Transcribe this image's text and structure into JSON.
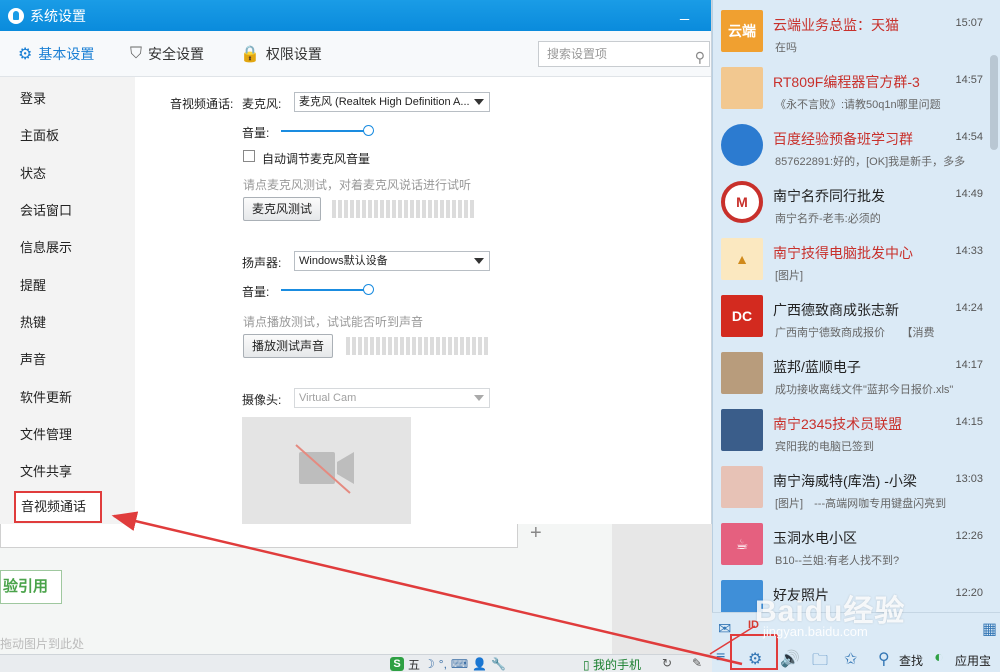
{
  "window": {
    "title": "系统设置"
  },
  "tabs": [
    {
      "label": "基本设置",
      "icon": "gear-icon"
    },
    {
      "label": "安全设置",
      "icon": "shield-icon"
    },
    {
      "label": "权限设置",
      "icon": "lock-icon"
    }
  ],
  "search": {
    "placeholder": "搜索设置项"
  },
  "sidebar": {
    "items": [
      "登录",
      "主面板",
      "状态",
      "会话窗口",
      "信息展示",
      "提醒",
      "热键",
      "声音",
      "软件更新",
      "文件管理",
      "文件共享",
      "音视频通话"
    ],
    "active": "音视频通话"
  },
  "av": {
    "section_label": "音视频通话:",
    "mic_label": "麦克风:",
    "mic_value": "麦克风 (Realtek High Definition A...",
    "volume_label": "音量:",
    "auto_adjust_label": "自动调节麦克风音量",
    "auto_adjust_checked": false,
    "mic_hint": "请点麦克风测试，对着麦克风说话进行试听",
    "mic_test_button": "麦克风测试",
    "speaker_label": "扬声器:",
    "speaker_value": "Windows默认设备",
    "speaker_volume_label": "音量:",
    "speaker_hint": "请点播放测试，试试能否听到声音",
    "speaker_test_button": "播放测试声音",
    "camera_label": "摄像头:",
    "camera_value": "Virtual Cam",
    "mic_volume": 1.0,
    "speaker_volume": 1.0
  },
  "background": {
    "quote_button": "验引用",
    "drag_hint": "拖动图片到此处",
    "plus": "+"
  },
  "taskbar": {
    "ime_label": "五",
    "phone_label": "我的手机"
  },
  "chats": [
    {
      "name": "云端业务总监：天猫",
      "time": "15:07",
      "preview": "在吗",
      "red": true,
      "avatar": "orange-box-avatar",
      "avatar_text": "云端"
    },
    {
      "name": "RT809F编程器官方群-3",
      "time": "14:57",
      "preview": "《永不言败》:请教50q1n哪里问题",
      "red": true,
      "avatar": "handshake-avatar",
      "avatar_text": ""
    },
    {
      "name": "百度经验预备班学习群",
      "time": "14:54",
      "preview": "857622891:好的，[OK]我是新手，多多",
      "red": true,
      "avatar": "paw-logo-avatar",
      "avatar_text": ""
    },
    {
      "name": "南宁名乔同行批发",
      "time": "14:49",
      "preview": "南宁名乔-老韦:必须的",
      "red": false,
      "avatar": "m-logo-avatar",
      "avatar_text": "M"
    },
    {
      "name": "南宁技得电脑批发中心",
      "time": "14:33",
      "preview": "[图片]",
      "red": true,
      "avatar": "tech-logo-avatar",
      "avatar_text": "▲"
    },
    {
      "name": "广西德致商成张志新",
      "time": "14:24",
      "preview": "广西南宁德致商成报价　　【消费",
      "red": false,
      "avatar": "dc-logo-avatar",
      "avatar_text": "DC"
    },
    {
      "name": "蓝邦/蓝顺电子",
      "time": "14:17",
      "preview": "成功接收离线文件\"蓝邦今日报价.xls\"",
      "red": false,
      "avatar": "photo-avatar",
      "avatar_text": ""
    },
    {
      "name": "南宁2345技术员联盟",
      "time": "14:15",
      "preview": "宾阳我的电脑已签到",
      "red": true,
      "avatar": "octopus-avatar",
      "avatar_text": ""
    },
    {
      "name": "南宁海威特(库浩) -小梁",
      "time": "13:03",
      "preview": "[图片]　---高端网咖专用键盘闪亮到",
      "red": false,
      "avatar": "girl-photo-avatar",
      "avatar_text": ""
    },
    {
      "name": "玉洞水电小区",
      "time": "12:26",
      "preview": "B10--兰姐:有老人找不到?",
      "red": false,
      "avatar": "cup-avatar",
      "avatar_text": "☕"
    },
    {
      "name": "好友照片",
      "time": "12:20",
      "preview": "",
      "red": false,
      "avatar": "photo-album-avatar",
      "avatar_text": ""
    }
  ],
  "chat_bottom": {
    "search_label": "查找",
    "app_label": "应用宝"
  },
  "watermark": {
    "text": "Baidu经验",
    "sub": "jingyan.baidu.com"
  },
  "colors": {
    "accent": "#1a8ce0",
    "highlight_red": "#e03c3c",
    "title_blue": "#0a8bdc"
  }
}
